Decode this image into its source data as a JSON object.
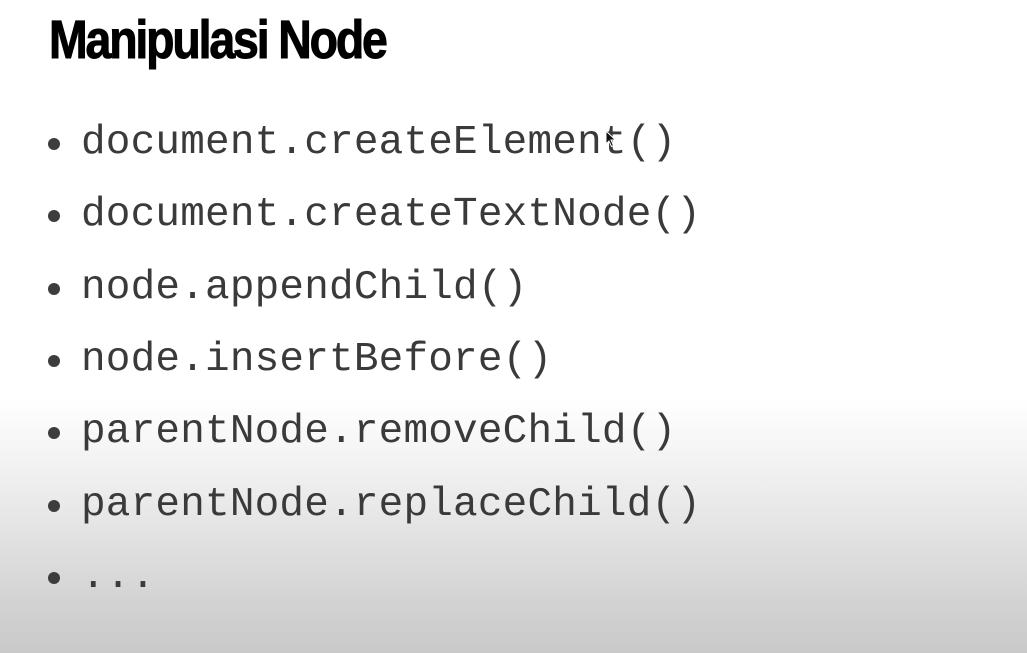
{
  "slide": {
    "title": "Manipulasi Node",
    "items": [
      "document.createElement()",
      "document.createTextNode()",
      "node.appendChild()",
      "node.insertBefore()",
      "parentNode.removeChild()",
      "parentNode.replaceChild()",
      "..."
    ]
  },
  "icons": {
    "bullet": "bullet-dot",
    "cursor": "mouse-pointer-icon"
  },
  "colors": {
    "title": "#000000",
    "text": "#3a3a3a",
    "bullet": "#3d3d3d"
  }
}
